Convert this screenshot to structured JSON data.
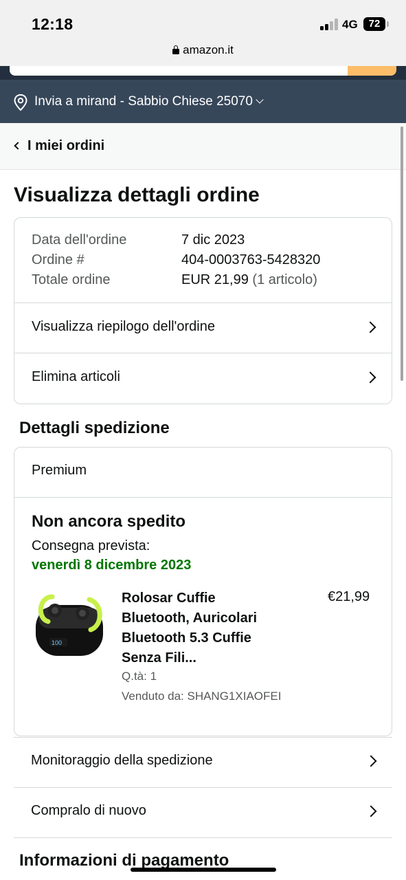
{
  "status_bar": {
    "time": "12:18",
    "network": "4G",
    "battery": "72"
  },
  "browser": {
    "url": "amazon.it"
  },
  "header": {
    "deliver_to": "Invia a mirand - Sabbio Chiese 25070"
  },
  "breadcrumb": {
    "label": "I miei ordini"
  },
  "page": {
    "title": "Visualizza dettagli ordine"
  },
  "order": {
    "date_label": "Data dell'ordine",
    "date_value": "7 dic 2023",
    "number_label": "Ordine #",
    "number_value": "404-0003763-5428320",
    "total_label": "Totale ordine",
    "total_value": "EUR 21,99",
    "total_items": "(1 articolo)",
    "summary_link": "Visualizza riepilogo dell'ordine",
    "delete_link": "Elimina articoli"
  },
  "shipment": {
    "section_title": "Dettagli spedizione",
    "type": "Premium",
    "status": "Non ancora spedito",
    "expected_label": "Consegna prevista:",
    "expected_date": "venerdì 8 dicembre 2023",
    "product": {
      "title": "Rolosar Cuffie Bluetooth, Auricolari Bluetooth 5.3 Cuffie Senza Fili...",
      "price": "€21,99",
      "quantity": "Q.tà: 1",
      "seller": "Venduto da: SHANG1XIAOFEI",
      "image": "wireless-earbuds-image"
    }
  },
  "actions": {
    "track": "Monitoraggio della spedizione",
    "buy_again": "Compralo di nuovo"
  },
  "payment": {
    "section_title": "Informazioni di pagamento"
  },
  "colors": {
    "header_dark": "#232f3e",
    "deliver_bar": "#37475a",
    "search_button": "#febd69",
    "delivery_green": "#007600"
  }
}
